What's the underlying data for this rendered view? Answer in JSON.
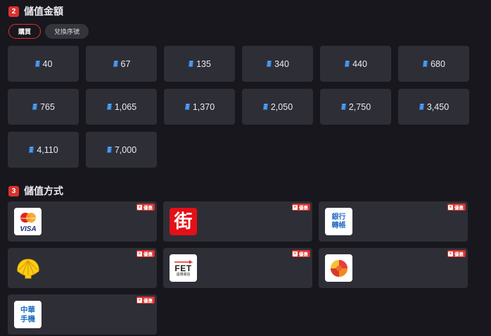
{
  "sections": {
    "amount": {
      "step": "2",
      "title": "儲值金額"
    },
    "method": {
      "step": "3",
      "title": "儲值方式"
    }
  },
  "tabs": [
    {
      "label": "購買",
      "active": true
    },
    {
      "label": "兌換序號",
      "active": false
    }
  ],
  "amounts": [
    "40",
    "67",
    "135",
    "340",
    "440",
    "680",
    "765",
    "1,065",
    "1,370",
    "2,050",
    "2,750",
    "3,450",
    "4,110",
    "7,000"
  ],
  "payment_methods": [
    {
      "name": "mastercard-visa",
      "promo": "優惠",
      "logo_text": [
        "VISA"
      ]
    },
    {
      "name": "street-payment",
      "promo": "優惠",
      "logo_text": [
        "街"
      ]
    },
    {
      "name": "bank-transfer",
      "promo": "優惠",
      "logo_text": [
        "銀行",
        "轉帳"
      ]
    },
    {
      "name": "shell-payment",
      "promo": "優惠"
    },
    {
      "name": "fet-telecom",
      "promo": "優惠",
      "logo_text": [
        "FET",
        "遠傳電信"
      ]
    },
    {
      "name": "colorful-wallet",
      "promo": "優惠"
    },
    {
      "name": "cht-telecom",
      "promo": "優惠",
      "logo_text": [
        "中華",
        "手機"
      ]
    }
  ],
  "colors": {
    "accent": "#d9322f",
    "background": "#18171d",
    "card": "#2e2e36",
    "gem": "#2f7fd6"
  }
}
